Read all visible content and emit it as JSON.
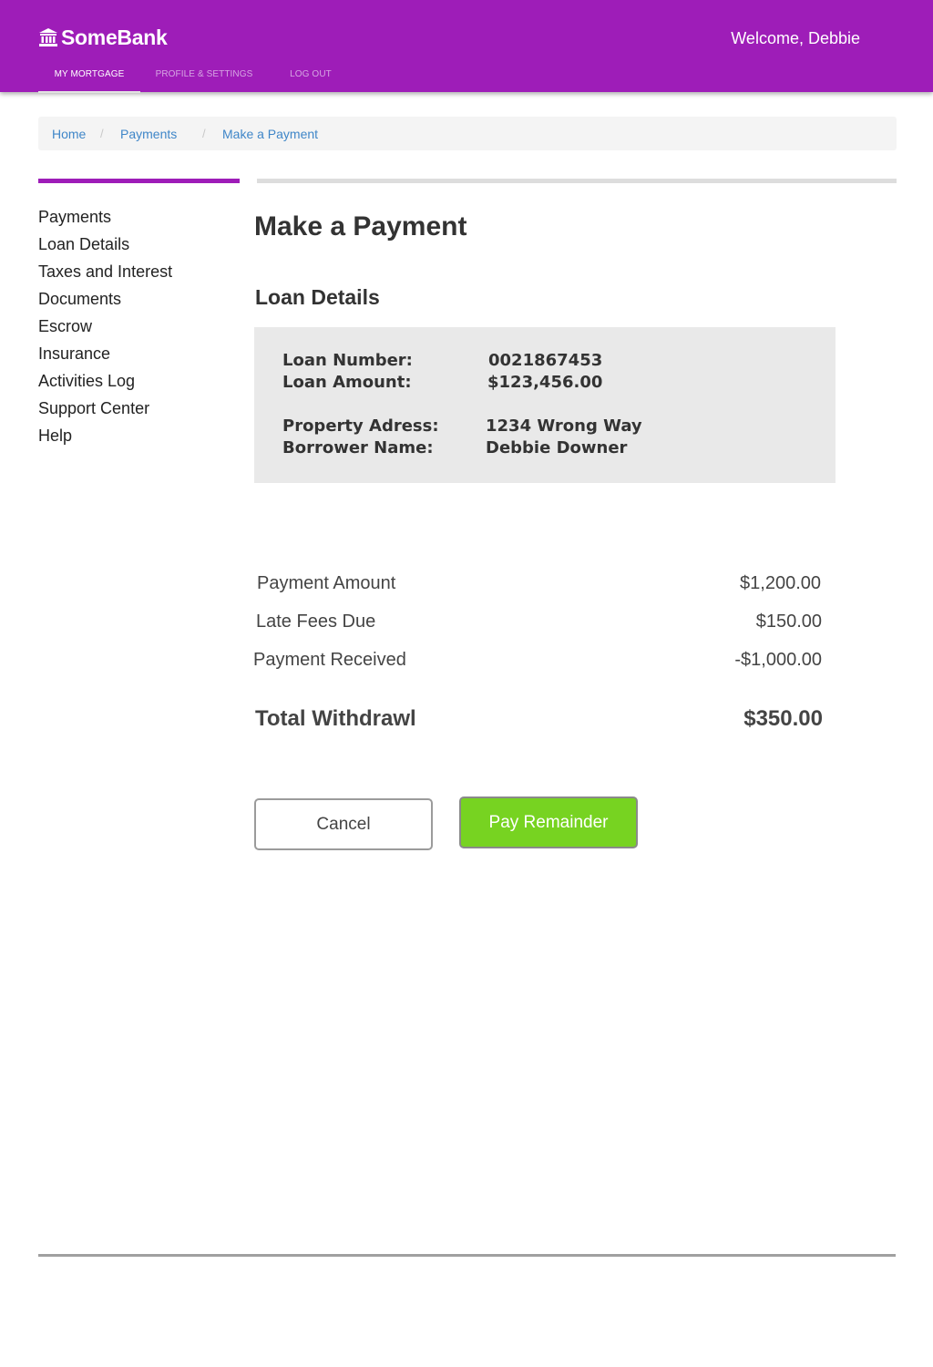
{
  "header": {
    "brand": "SomeBank",
    "welcome": "Welcome, Debbie",
    "tabs": [
      {
        "label": "MY MORTGAGE",
        "active": true
      },
      {
        "label": "PROFILE & SETTINGS",
        "active": false
      },
      {
        "label": "LOG OUT",
        "active": false
      }
    ]
  },
  "breadcrumb": {
    "items": [
      "Home",
      "Payments",
      "Make a Payment"
    ],
    "separator": "/"
  },
  "sidebar": {
    "items": [
      {
        "label": "Payments"
      },
      {
        "label": "Loan Details"
      },
      {
        "label": "Taxes and Interest"
      },
      {
        "label": "Documents"
      },
      {
        "label": "Escrow"
      },
      {
        "label": "Insurance"
      },
      {
        "label": "Activities Log"
      },
      {
        "label": "Support Center"
      },
      {
        "label": "Help"
      }
    ]
  },
  "main": {
    "title": "Make a Payment",
    "section_title": "Loan Details",
    "loan": {
      "number_label": "Loan Number:",
      "number_value": "0021867453",
      "amount_label": "Loan Amount:",
      "amount_value": "$123,456.00",
      "property_label": "Property Adress:",
      "property_value": "1234 Wrong Way",
      "borrower_label": "Borrower Name:",
      "borrower_value": "Debbie Downer"
    },
    "payments": [
      {
        "label": "Payment Amount",
        "value": "$1,200.00"
      },
      {
        "label": "Late Fees Due",
        "value": "$150.00"
      },
      {
        "label": "Payment Received",
        "value": "-$1,000.00"
      }
    ],
    "total_label": "Total Withdrawl",
    "total_value": "$350.00",
    "cancel_label": "Cancel",
    "pay_label": "Pay Remainder"
  },
  "colors": {
    "brand_purple": "#9e1db8",
    "pay_green": "#77d321",
    "link_blue": "#3f86c8"
  },
  "icons": {
    "brand": "bank-icon"
  }
}
